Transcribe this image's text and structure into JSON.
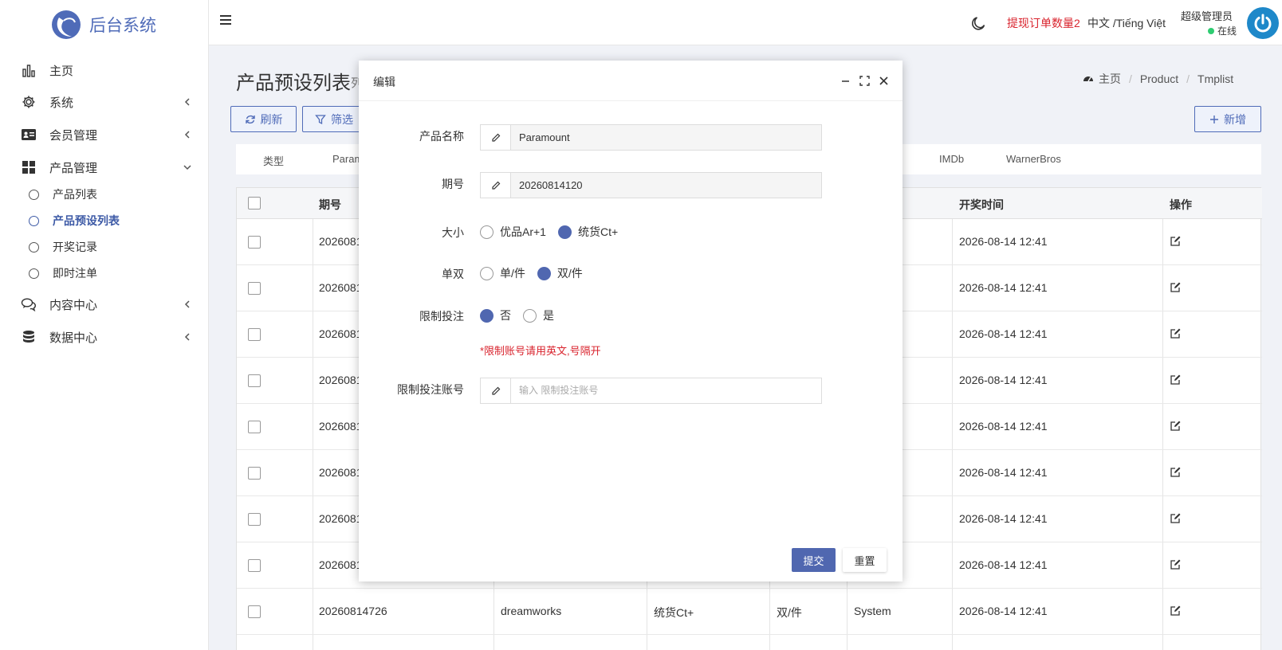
{
  "brand": {
    "title": "后台系统",
    "accent": "#4f6bb8"
  },
  "sidebar": {
    "items": [
      {
        "label": "主页",
        "icon": "bar-chart-icon"
      },
      {
        "label": "系统",
        "icon": "gear-icon"
      },
      {
        "label": "会员管理",
        "icon": "id-card-icon"
      },
      {
        "label": "产品管理",
        "icon": "grid-icon"
      },
      {
        "label": "内容中心",
        "icon": "comments-icon"
      },
      {
        "label": "数据中心",
        "icon": "database-icon"
      }
    ],
    "sub_items": [
      {
        "label": "产品列表"
      },
      {
        "label": "产品预设列表"
      },
      {
        "label": "开奖记录"
      },
      {
        "label": "即时注单"
      }
    ]
  },
  "header": {
    "withdraw": "提现订单数量2",
    "lang": "中文 /Tiếng Việt",
    "user": "超级管理员",
    "status": "在线"
  },
  "page": {
    "title": "产品预设列表",
    "subtitle": "列",
    "breadcrumb": [
      "主页",
      "Product",
      "Tmplist"
    ],
    "buttons": {
      "refresh": "刷新",
      "filter": "筛选",
      "add": "新增"
    }
  },
  "filters": [
    "类型",
    "Param",
    "IMDb",
    "WarnerBros"
  ],
  "table": {
    "headers": {
      "period": "期号",
      "draw_time": "开奖时间",
      "actions": "操作"
    },
    "rows": [
      {
        "period": "2026081",
        "draw_time": "2026-08-14 12:41"
      },
      {
        "period": "2026081",
        "draw_time": "2026-08-14 12:41"
      },
      {
        "period": "2026081",
        "draw_time": "2026-08-14 12:41"
      },
      {
        "period": "2026081",
        "draw_time": "2026-08-14 12:41"
      },
      {
        "period": "2026081",
        "draw_time": "2026-08-14 12:41"
      },
      {
        "period": "2026081",
        "draw_time": "2026-08-14 12:41"
      },
      {
        "period": "2026081",
        "draw_time": "2026-08-14 12:41"
      },
      {
        "period": "2026081",
        "draw_time": "2026-08-14 12:41"
      }
    ],
    "last_row": {
      "period": "20260814726",
      "product": "dreamworks",
      "size": "统货Ct+",
      "parity": "双/件",
      "source": "System",
      "draw_time": "2026-08-14 12:41"
    }
  },
  "modal": {
    "title": "编辑",
    "product_name_label": "产品名称",
    "product_name_value": "Paramount",
    "period_label": "期号",
    "period_value": "20260814120",
    "size_label": "大小",
    "size_options": [
      "优品Ar+1",
      "统货Ct+"
    ],
    "parity_label": "单双",
    "parity_options": [
      "单/件",
      "双/件"
    ],
    "limit_label": "限制投注",
    "limit_options": [
      "否",
      "是"
    ],
    "hint": "*限制账号请用英文,号隔开",
    "limit_account_label": "限制投注账号",
    "limit_account_placeholder": "输入 限制投注账号",
    "submit": "提交",
    "reset": "重置"
  }
}
